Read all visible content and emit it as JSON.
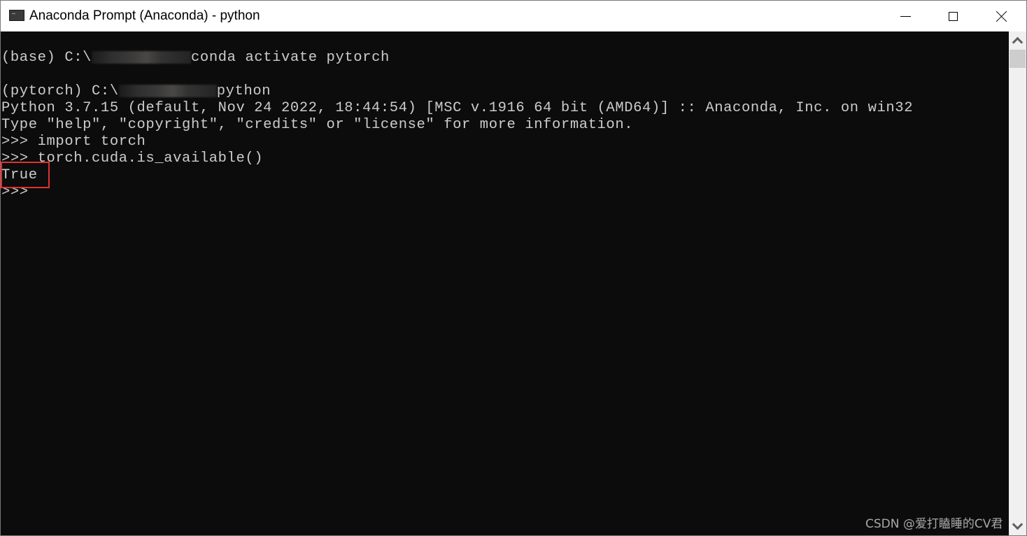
{
  "window": {
    "title": "Anaconda Prompt (Anaconda) - python",
    "app_icon": "console-icon",
    "controls": {
      "minimize": "minimize-icon",
      "maximize": "maximize-icon",
      "close": "close-icon"
    }
  },
  "console": {
    "lines": [
      {
        "prefix": "(base) C:\\",
        "redacted": true,
        "suffix": "conda activate pytorch"
      },
      {
        "text": ""
      },
      {
        "prefix": "(pytorch) C:\\",
        "redacted": true,
        "suffix": "python"
      },
      {
        "text": "Python 3.7.15 (default, Nov 24 2022, 18:44:54) [MSC v.1916 64 bit (AMD64)] :: Anaconda, Inc. on win32"
      },
      {
        "text": "Type \"help\", \"copyright\", \"credits\" or \"license\" for more information."
      },
      {
        "text": ">>> import torch"
      },
      {
        "text": ">>> torch.cuda.is_available()"
      },
      {
        "text": "True"
      },
      {
        "text": ">>>"
      }
    ],
    "highlighted_output": "True",
    "highlight_color": "#e0312f",
    "background_color": "#0c0c0c",
    "text_color": "#cccccc"
  },
  "scrollbar": {
    "up_icon": "chevron-up-icon",
    "down_icon": "chevron-down-icon"
  },
  "watermark": "CSDN @爱打瞌睡的CV君"
}
